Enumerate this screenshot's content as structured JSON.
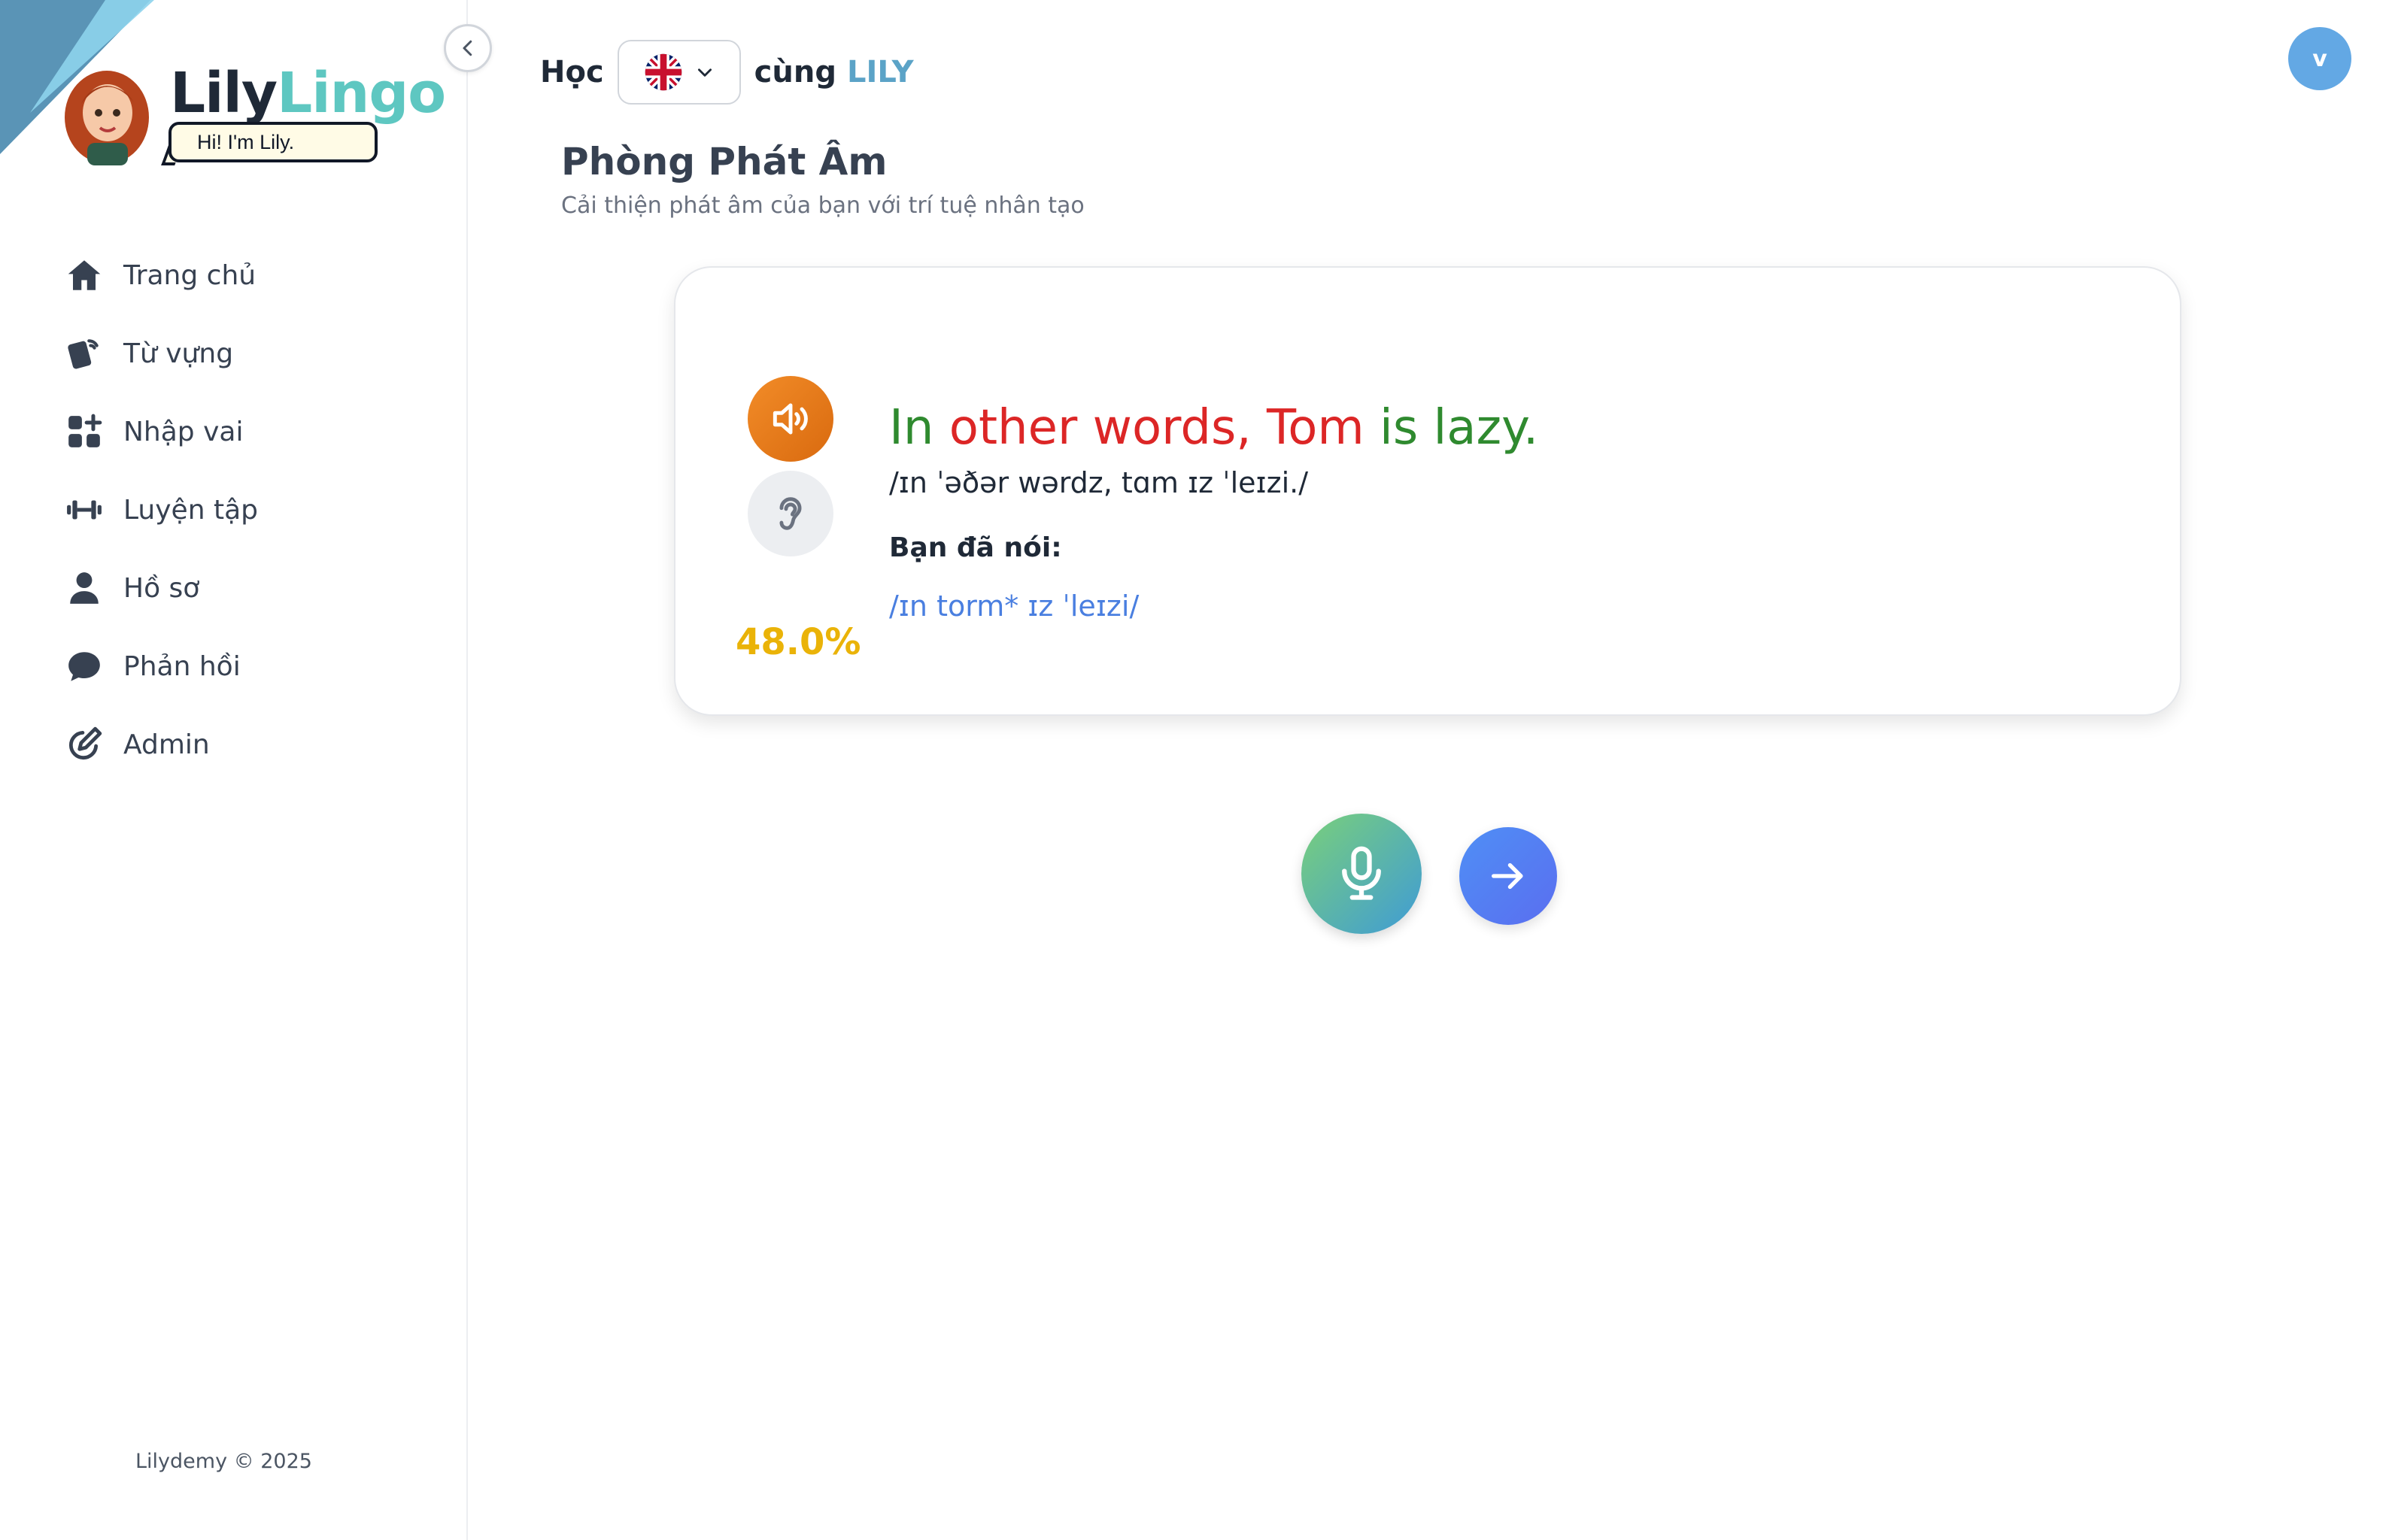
{
  "sidebar": {
    "brand_part1": "Lily",
    "brand_part2": "Lingo",
    "bubble_text": "Hi! I'm Lily.",
    "items": [
      {
        "label": "Trang chủ",
        "icon": "home-icon"
      },
      {
        "label": "Từ vựng",
        "icon": "cards-icon"
      },
      {
        "label": "Nhập vai",
        "icon": "apps-add-icon"
      },
      {
        "label": "Luyện tập",
        "icon": "dumbbell-icon"
      },
      {
        "label": "Hồ sơ",
        "icon": "user-icon"
      },
      {
        "label": "Phản hồi",
        "icon": "chat-bubble-icon"
      },
      {
        "label": "Admin",
        "icon": "edit-icon"
      }
    ],
    "footer": "Lilydemy © 2025"
  },
  "header": {
    "learn_label": "Học",
    "with_label": "cùng",
    "lily_label": "LILY",
    "language_flag": "uk-flag-icon",
    "user_initial": "v"
  },
  "page": {
    "title": "Phòng Phát Âm",
    "subtitle": "Cải thiện phát âm của bạn với trí tuệ nhân tạo"
  },
  "exercise": {
    "words": [
      {
        "text": "In",
        "status": "correct"
      },
      {
        "text": "other",
        "status": "incorrect"
      },
      {
        "text": "words,",
        "status": "incorrect"
      },
      {
        "text": "Tom",
        "status": "incorrect"
      },
      {
        "text": "is",
        "status": "correct"
      },
      {
        "text": "lazy.",
        "status": "correct"
      }
    ],
    "ipa": "/ɪn ˈəðər wərdz, tɑm ɪz ˈleɪzi./",
    "you_said_label": "Bạn đã nói:",
    "you_said_ipa": "/ɪn torm* ɪz ˈleɪzi/",
    "score": "48.0%"
  },
  "colors": {
    "correct": "#2f8a2f",
    "incorrect": "#dc2626",
    "score": "#eab308",
    "accent_teal": "#5ec7c1",
    "said": "#4a7fe0"
  }
}
